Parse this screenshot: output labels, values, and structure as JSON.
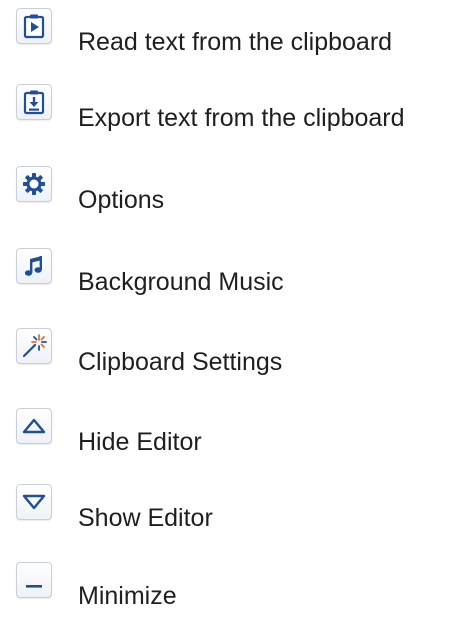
{
  "menu": {
    "items": [
      {
        "label": "Read text from the clipboard",
        "icon": "clipboard-play-icon"
      },
      {
        "label": "Export text from the clipboard",
        "icon": "clipboard-download-icon"
      },
      {
        "label": "Options",
        "icon": "gear-icon"
      },
      {
        "label": "Background Music",
        "icon": "music-note-icon"
      },
      {
        "label": "Clipboard Settings",
        "icon": "magic-wand-icon"
      },
      {
        "label": "Hide Editor",
        "icon": "triangle-up-icon"
      },
      {
        "label": "Show Editor",
        "icon": "triangle-down-icon"
      },
      {
        "label": "Minimize",
        "icon": "minimize-icon"
      }
    ]
  },
  "colors": {
    "icon_blue": "#1f4e9c",
    "icon_border": "#c9cfd8",
    "text": "#1f1f1f"
  }
}
